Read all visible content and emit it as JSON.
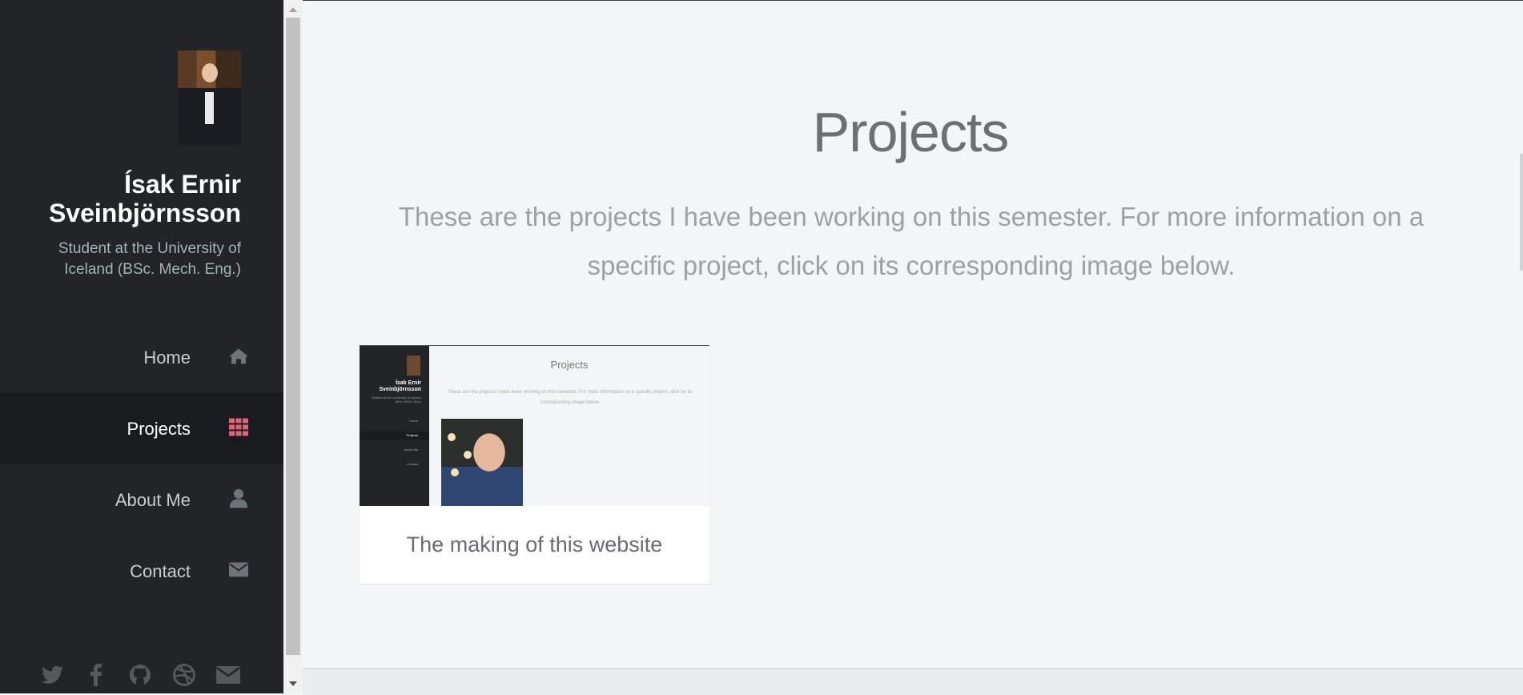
{
  "sidebar": {
    "name": "Ísak Ernir Sveinbjörnsson",
    "subtitle": "Student at the University of Iceland (BSc. Mech. Eng.)",
    "nav": [
      {
        "label": "Home",
        "icon": "home-icon"
      },
      {
        "label": "Projects",
        "icon": "grid-icon",
        "active": true
      },
      {
        "label": "About Me",
        "icon": "user-icon"
      },
      {
        "label": "Contact",
        "icon": "envelope-icon"
      }
    ],
    "social": [
      "twitter-icon",
      "facebook-icon",
      "github-icon",
      "dribbble-icon",
      "envelope-icon"
    ]
  },
  "main": {
    "title": "Projects",
    "intro": "These are the projects I have been working on this semester. For more information on a specific project, click on its corresponding image below.",
    "projects": [
      {
        "caption": "The making of this website",
        "thumbnail": {
          "name": "Ísak Ernir Sveinbjörnsson",
          "subtitle": "Student at the University of Iceland (BSc. Mech. Eng.)",
          "nav": [
            "Home",
            "Projects",
            "About Me",
            "Contact"
          ],
          "title": "Projects",
          "intro": "These are the projects I have been working on this semester. For more information on a specific project, click on its corresponding image below."
        }
      }
    ]
  },
  "colors": {
    "sidebar_bg": "#212528",
    "sidebar_active_bg": "#191c1e",
    "accent": "#e2637a",
    "icon_gray": "#6f7478",
    "page_bg": "#f3f6f6"
  }
}
